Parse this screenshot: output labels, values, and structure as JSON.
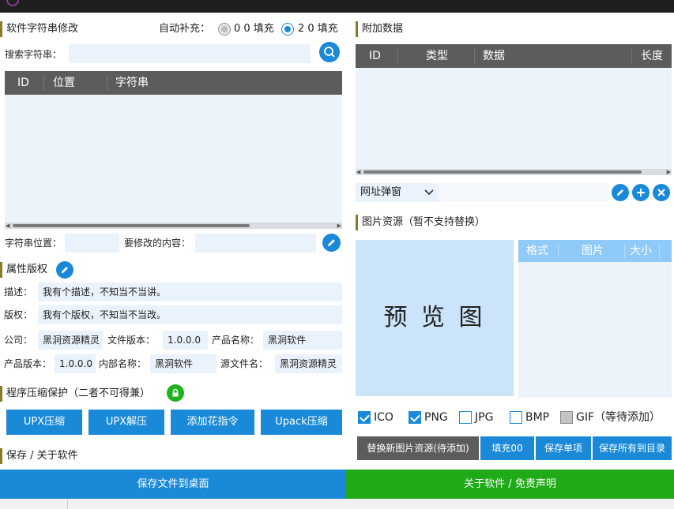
{
  "left": {
    "string_section_title": "软件字符串修改",
    "auto_fill_label": "自动补充：",
    "radio_00_label": "0 0 填充",
    "radio_20_label": "2 0 填充",
    "search_label": "搜索字符串：",
    "search_value": "",
    "string_table": {
      "columns": [
        "ID",
        "位置",
        "字符串"
      ]
    },
    "string_pos_label": "字符串位置：",
    "modify_label": "要修改的内容：",
    "attr_section_title": "属性版权",
    "desc_label": "描述：",
    "desc_value": "我有个描述，不知当不当讲。",
    "copyright_label": "版权：",
    "copyright_value": "我有个版权，不知当不当改。",
    "company_label": "公司：",
    "company_value": "黑洞资源精灵",
    "file_version_label": "文件版本：",
    "file_version_value": "1.0.0.0",
    "product_name_label": "产品名称：",
    "product_name_value": "黑洞软件",
    "product_version_label": "产品版本：",
    "product_version_value": "1.0.0.0",
    "internal_name_label": "内部名称：",
    "internal_name_value": "黑洞软件",
    "source_file_label": "源文件名：",
    "source_file_value": "黑洞资源精灵",
    "compress_section_title": "程序压缩保护（二者不可得兼）",
    "compress_buttons": [
      "UPX压缩",
      "UPX解压",
      "添加花指令",
      "Upack压缩"
    ],
    "save_section_title": "保存 / 关于软件"
  },
  "right": {
    "extra_section_title": "附加数据",
    "extra_table": {
      "columns": [
        "ID",
        "类型",
        "数据",
        "长度"
      ]
    },
    "url_popup_select": "网址弹窗",
    "image_section_title": "图片资源（暂不支持替换）",
    "preview_text": "预 览 图",
    "image_table": {
      "columns": [
        "格式",
        "图片",
        "大小"
      ]
    },
    "formats": [
      {
        "label": "ICO",
        "checked": true
      },
      {
        "label": "PNG",
        "checked": true
      },
      {
        "label": "JPG",
        "checked": false
      },
      {
        "label": "BMP",
        "checked": false
      },
      {
        "label": "GIF（等待添加）",
        "checked": false,
        "disabled": true
      }
    ],
    "action_buttons": [
      "替换新图片资源(待添加)",
      "填充00",
      "保存单项",
      "保存所有到目录"
    ]
  },
  "bottom": {
    "save_desktop": "保存文件到桌面",
    "about": "关于软件 / 免责声明"
  },
  "colors": {
    "accent": "#1a8ad8",
    "green": "#1faa18",
    "header": "#5c5c5c",
    "field": "#eaf2fb",
    "titlebar": "#201f1f"
  }
}
